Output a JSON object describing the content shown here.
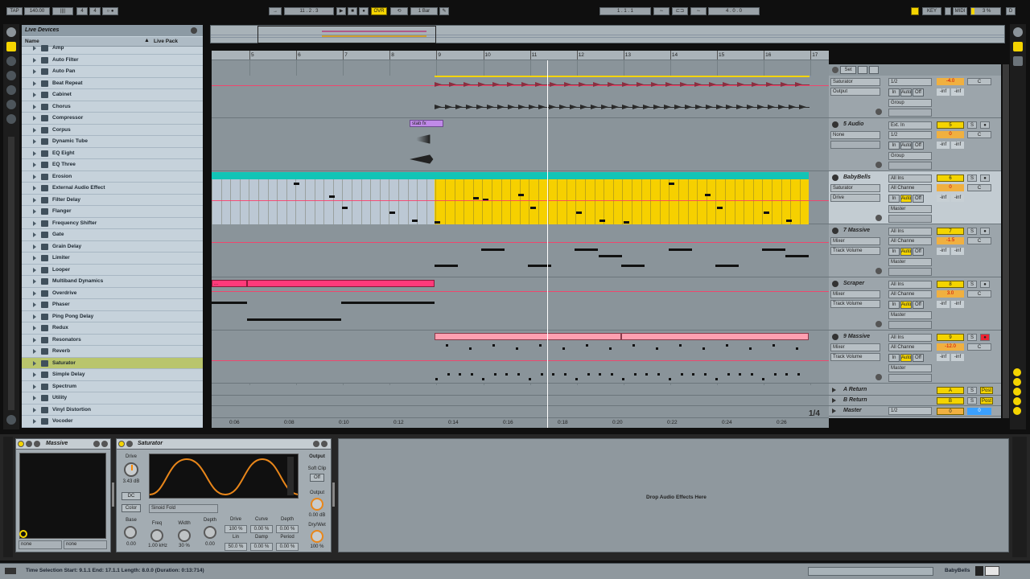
{
  "toolbar": {
    "tap": "TAP",
    "tempo": "140.00",
    "sig_a": "4",
    "sig_b": "4",
    "sig_label": "||||",
    "loop_label": "○ ●",
    "pos_bar": "11",
    "pos_beat": "2",
    "pos_sixteenth": "3",
    "ovr": "OVR",
    "quant": "1 Bar",
    "loop_start": "1 . 1 . 1",
    "loop_len": "4 . 0 . 0",
    "key": "KEY",
    "midi": "MIDI",
    "cpu": "3 %",
    "d": "D"
  },
  "browser": {
    "title": "Live Devices",
    "col_name": "Name",
    "col_pack": "Live Pack",
    "items": [
      "Amp",
      "Auto Filter",
      "Auto Pan",
      "Beat Repeat",
      "Cabinet",
      "Chorus",
      "Compressor",
      "Corpus",
      "Dynamic Tube",
      "EQ Eight",
      "EQ Three",
      "Erosion",
      "External Audio Effect",
      "Filter Delay",
      "Flanger",
      "Frequency Shifter",
      "Gate",
      "Grain Delay",
      "Limiter",
      "Looper",
      "Multiband Dynamics",
      "Overdrive",
      "Phaser",
      "Ping Pong Delay",
      "Redux",
      "Resonators",
      "Reverb",
      "Saturator",
      "Simple Delay",
      "Spectrum",
      "Utility",
      "Vinyl Distortion",
      "Vocoder"
    ],
    "selected": "Saturator"
  },
  "ruler": {
    "bars": [
      "5",
      "6",
      "7",
      "8",
      "9",
      "10",
      "11",
      "12",
      "13",
      "14",
      "15",
      "16",
      "17"
    ],
    "times": [
      "0:06",
      "0:08",
      "0:10",
      "0:12",
      "0:14",
      "0:16",
      "0:18",
      "0:20",
      "0:22",
      "0:24",
      "0:26"
    ]
  },
  "clips": {
    "stab": "stab fx",
    "small1": "...",
    "small2": "..."
  },
  "mixer": {
    "set_label": "Set",
    "zoom": "1/4",
    "tracks": [
      {
        "name": "",
        "dev": "Saturator",
        "param": "Output",
        "in1": "",
        "in2": "1/2",
        "num": "",
        "vol": "-4.0",
        "pan": "C",
        "mon": [
          "In",
          "Auto",
          "Off"
        ],
        "l": "-inf",
        "r": "-inf",
        "out": "Group"
      },
      {
        "name": "5 Audio",
        "dev": "None",
        "param": "",
        "in1": "Ext. In",
        "in2": "1/2",
        "num": "5",
        "vol": "0",
        "pan": "C",
        "mon": [
          "In",
          "Auto",
          "Off"
        ],
        "l": "-inf",
        "r": "-inf",
        "out": "Group"
      },
      {
        "name": "BabyBells",
        "dev": "Saturator",
        "param": "Drive",
        "in1": "All Ins",
        "in2": "All Channe",
        "num": "6",
        "vol": "0",
        "pan": "C",
        "mon": [
          "In",
          "Auto",
          "Off"
        ],
        "l": "-inf",
        "r": "-inf",
        "out": "Master"
      },
      {
        "name": "7 Massive",
        "dev": "Mixer",
        "param": "Track Volume",
        "in1": "All Ins",
        "in2": "All Channe",
        "num": "7",
        "vol": "-1.5",
        "pan": "C",
        "mon": [
          "In",
          "Auto",
          "Off"
        ],
        "l": "-inf",
        "r": "-inf",
        "out": "Master"
      },
      {
        "name": "Scraper",
        "dev": "Mixer",
        "param": "Track Volume",
        "in1": "All Ins",
        "in2": "All Channe",
        "num": "8",
        "vol": "3.0",
        "pan": "C",
        "mon": [
          "In",
          "Auto",
          "Off"
        ],
        "l": "-inf",
        "r": "-inf",
        "out": "Master"
      },
      {
        "name": "9 Massive",
        "dev": "Mixer",
        "param": "Track Volume",
        "in1": "All Ins",
        "in2": "All Channe",
        "num": "9",
        "vol": "-12.0",
        "pan": "C",
        "mon": [
          "In",
          "Auto",
          "Off"
        ],
        "l": "-inf",
        "r": "-inf",
        "out": "Master"
      }
    ],
    "returns": [
      {
        "name": "A Return",
        "num": "A",
        "s": "S",
        "post": "Post"
      },
      {
        "name": "B Return",
        "num": "B",
        "s": "S",
        "post": "Post"
      },
      {
        "name": "Master",
        "num": "0",
        "in": "1/2",
        "pan": "0"
      }
    ]
  },
  "devices": {
    "massive": {
      "title": "Massive",
      "sel1": "none",
      "sel2": "none"
    },
    "saturator": {
      "title": "Saturator",
      "drive_label": "Drive",
      "drive_val": "3.43 dB",
      "dc": "DC",
      "color": "Color",
      "mode": "Sinoid Fold",
      "output_label": "Output",
      "softclip": "Soft Clip",
      "softclip_val": "Off",
      "output_knob": "Output",
      "output_val": "0.00 dB",
      "drywet": "Dry/Wet",
      "drywet_val": "100 %",
      "base": "Base",
      "base_val": "0.00",
      "freq": "Freq",
      "freq_val": "1.00 kHz",
      "width": "Width",
      "width_val": "30 %",
      "depth": "Depth",
      "depth_val": "0.00",
      "grid": [
        [
          "Drive",
          "Curve",
          "Depth"
        ],
        [
          "100 %",
          "0.00 %",
          "0.00 %"
        ],
        [
          "Lin",
          "Damp",
          "Period"
        ],
        [
          "50.0 %",
          "0.00 %",
          "0.00 %"
        ]
      ]
    },
    "drop": "Drop Audio Effects Here"
  },
  "status": {
    "text": "Time Selection   Start: 9.1.1   End: 17.1.1   Length: 8.0.0  (Duration: 0:13:714)",
    "track": "BabyBells"
  },
  "colors": {
    "accent": "#f4d400",
    "teal": "#12c4b6",
    "pink": "#ff3a7a",
    "lightpink": "#ff9fb0",
    "orange": "#ff8a00"
  }
}
